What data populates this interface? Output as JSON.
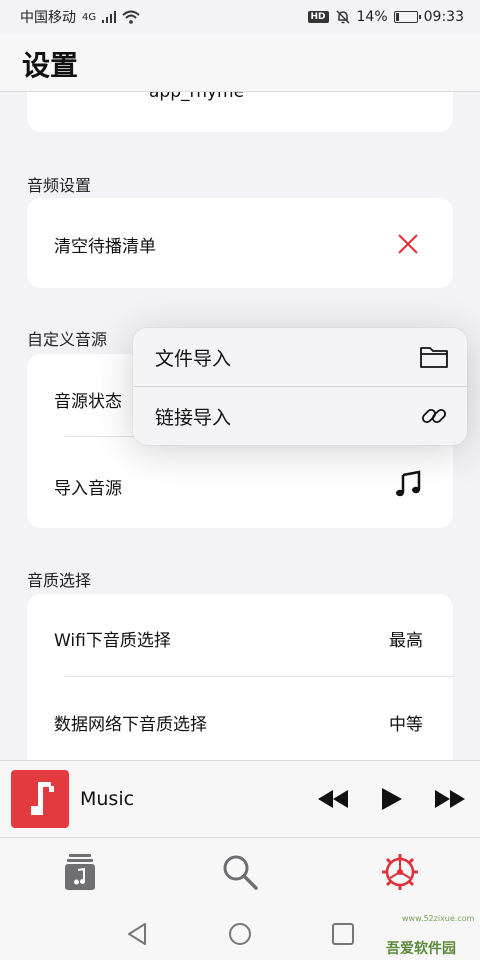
{
  "status_bar": {
    "carrier": "中国移动",
    "network": "4G",
    "hd": "HD",
    "battery": "14%",
    "battery_level": 0.14,
    "time": "09:33"
  },
  "header": {
    "title": "设置"
  },
  "sections": {
    "top_card": {
      "value": "app_rhyme"
    },
    "audio": {
      "label": "音频设置",
      "clear_queue": "清空待播清单"
    },
    "custom_source": {
      "label": "自定义音源",
      "status": "音源状态",
      "import": "导入音源"
    },
    "quality": {
      "label": "音质选择",
      "wifi": "Wifi下音质选择",
      "wifi_value": "最高",
      "mobile": "数据网络下音质选择",
      "mobile_value": "中等"
    }
  },
  "popup_menu": {
    "items": [
      {
        "label": "文件导入",
        "icon": "folder-icon"
      },
      {
        "label": "链接导入",
        "icon": "link-icon"
      }
    ]
  },
  "player": {
    "title": "Music"
  },
  "tabs": [
    {
      "icon": "library-icon"
    },
    {
      "icon": "search-icon"
    },
    {
      "icon": "settings-gear-icon",
      "active": true
    }
  ],
  "colors": {
    "accent": "#e0303a",
    "cover": "#e23a3e",
    "background": "#f2f2f7"
  },
  "watermark": {
    "text": "吾爱软件园",
    "url": "www.52zixue.com"
  }
}
